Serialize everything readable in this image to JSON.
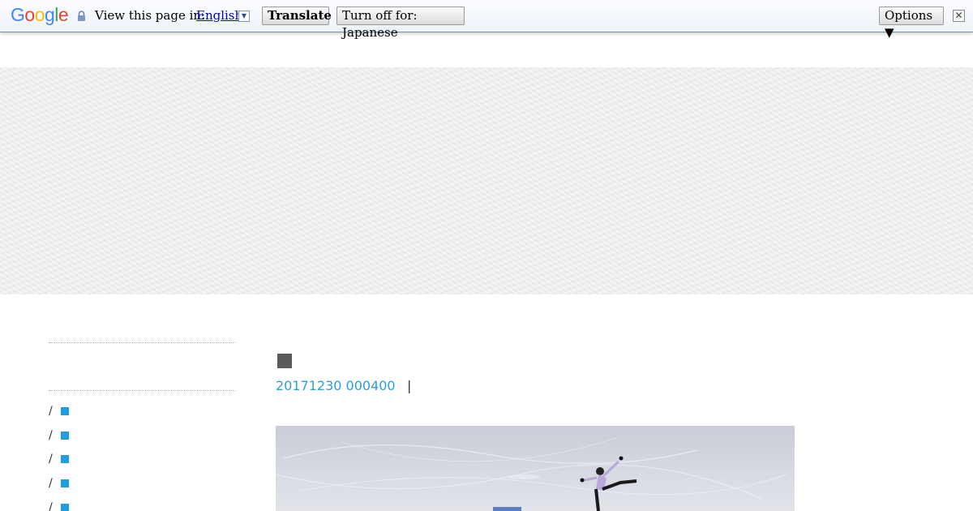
{
  "translate_bar": {
    "logo": "Google",
    "label": "View this page in:",
    "language": "English",
    "translate_button": "Translate",
    "turn_off_button": "Turn off for: Japanese",
    "options_button": "Options ▼",
    "close": "✕"
  },
  "post": {
    "mark": "■",
    "date": "20171230 000400",
    "separator": "|"
  },
  "sidebar": {
    "items": [
      {
        "prefix": "/"
      },
      {
        "prefix": "/"
      },
      {
        "prefix": "/"
      },
      {
        "prefix": "/"
      },
      {
        "prefix": "/"
      }
    ]
  },
  "colors": {
    "link": "#2b9fd9",
    "accent_square": "#1e9de0",
    "post_mark": "#5a5a5a",
    "banner": "#efefef"
  }
}
